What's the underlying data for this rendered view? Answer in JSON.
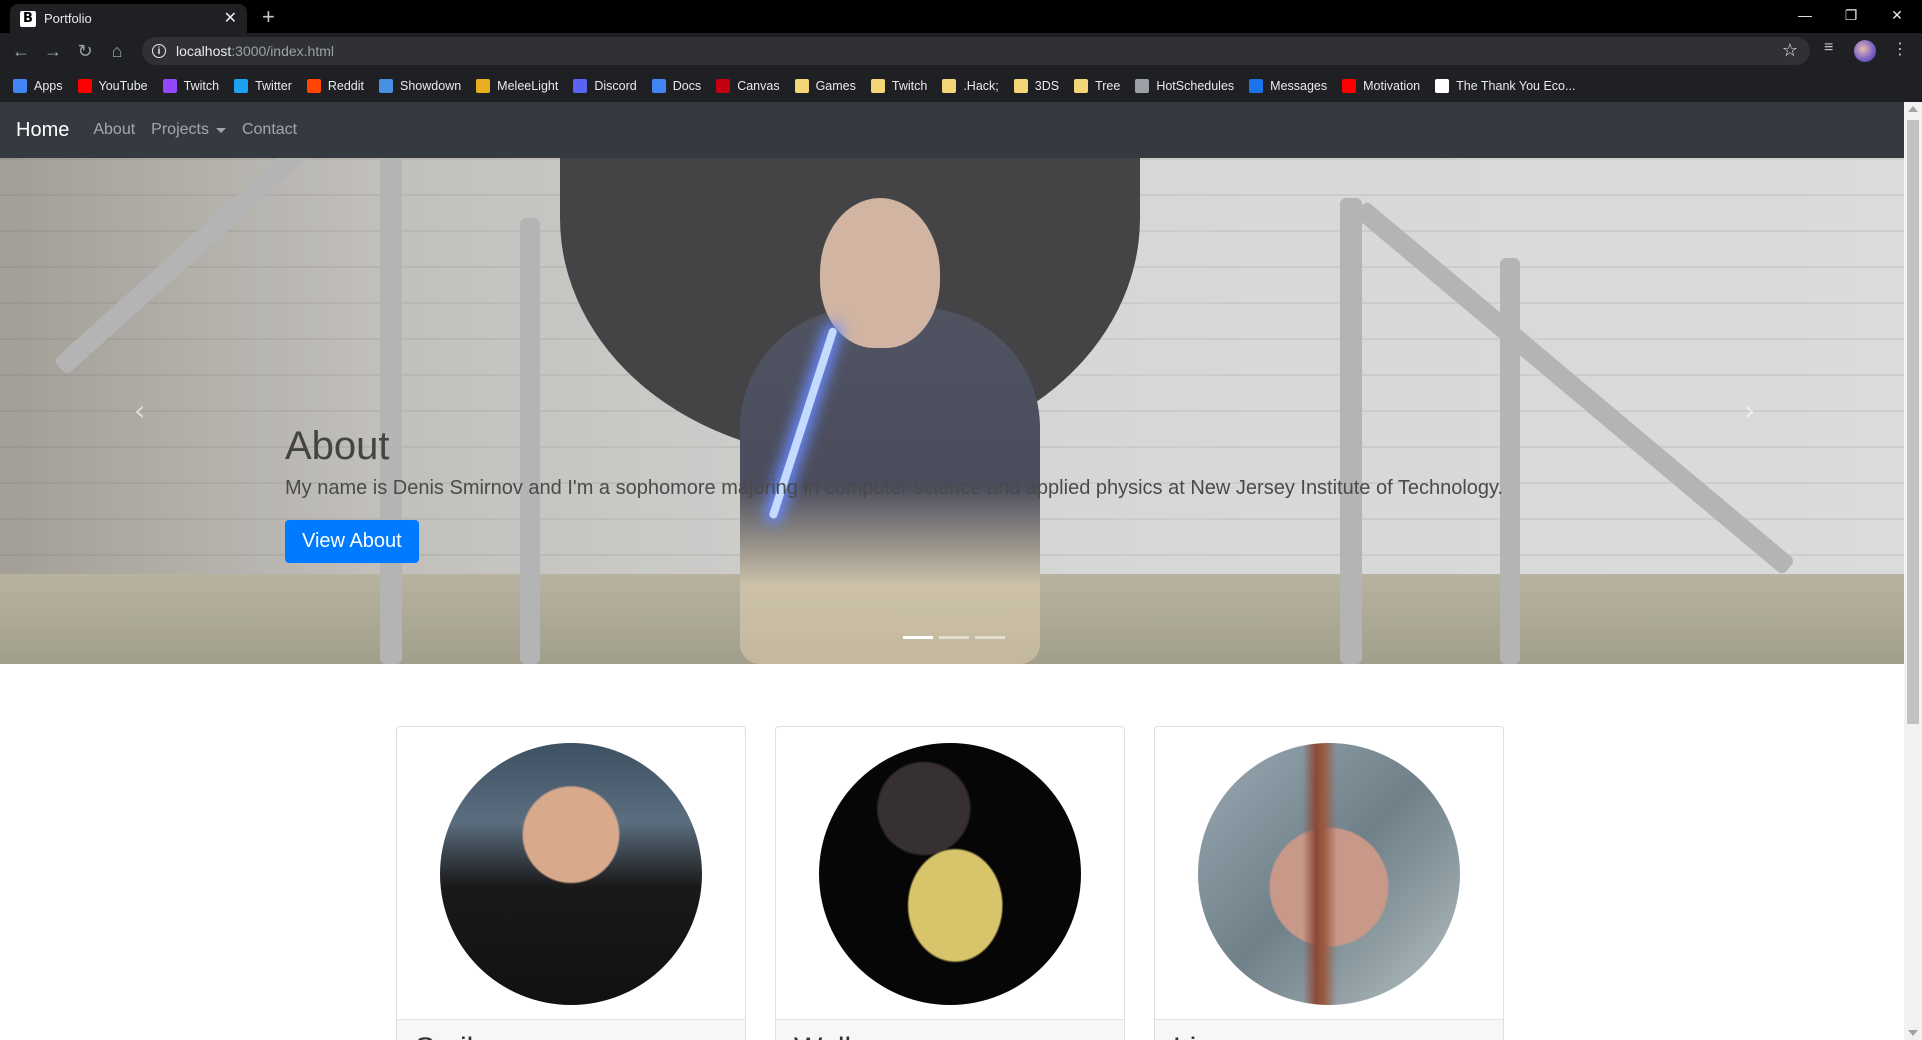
{
  "browser": {
    "tab_title": "Portfolio",
    "tab_favicon": "B",
    "url_host": "localhost",
    "url_rest": ":3000/index.html",
    "bookmarks": [
      {
        "label": "Apps",
        "icon": "apps-grid-icon",
        "color": "#4285f4"
      },
      {
        "label": "YouTube",
        "icon": "youtube-icon",
        "color": "#ff0000"
      },
      {
        "label": "Twitch",
        "icon": "twitch-icon",
        "color": "#9146ff"
      },
      {
        "label": "Twitter",
        "icon": "twitter-icon",
        "color": "#1da1f2"
      },
      {
        "label": "Reddit",
        "icon": "reddit-icon",
        "color": "#ff4500"
      },
      {
        "label": "Showdown",
        "icon": "showdown-icon",
        "color": "#4a90e2"
      },
      {
        "label": "MeleeLight",
        "icon": "meleelight-icon",
        "color": "#e8b020"
      },
      {
        "label": "Discord",
        "icon": "discord-icon",
        "color": "#5865f2"
      },
      {
        "label": "Docs",
        "icon": "docs-icon",
        "color": "#4285f4"
      },
      {
        "label": "Canvas",
        "icon": "canvas-icon",
        "color": "#c4000e"
      },
      {
        "label": "Games",
        "icon": "folder-icon",
        "color": "#f4d678"
      },
      {
        "label": "Twitch",
        "icon": "folder-icon",
        "color": "#f4d678"
      },
      {
        "label": ".Hack;",
        "icon": "folder-icon",
        "color": "#f4d678"
      },
      {
        "label": "3DS",
        "icon": "folder-icon",
        "color": "#f4d678"
      },
      {
        "label": "Tree",
        "icon": "folder-icon",
        "color": "#f4d678"
      },
      {
        "label": "HotSchedules",
        "icon": "hotschedules-icon",
        "color": "#9aa0a6"
      },
      {
        "label": "Messages",
        "icon": "messages-icon",
        "color": "#1a73e8"
      },
      {
        "label": "Motivation",
        "icon": "youtube-icon",
        "color": "#ff0000"
      },
      {
        "label": "The Thank You Eco...",
        "icon": "bookmark-b-icon",
        "color": "#ffffff"
      }
    ]
  },
  "nav": {
    "brand": "Home",
    "links": [
      "About",
      "Projects",
      "Contact"
    ]
  },
  "hero": {
    "title": "About",
    "text": "My name is Denis Smirnov and I'm a sophomore majoring in computer science and applied physics at New Jersey Institute of Technology.",
    "button": "View About",
    "prev_glyph": "‹",
    "next_glyph": "›"
  },
  "cards": [
    {
      "footer": "Smil"
    },
    {
      "footer": "Walk"
    },
    {
      "footer": "Lies"
    }
  ],
  "colors": {
    "navbar": "#343a40",
    "primary": "#007bff"
  }
}
